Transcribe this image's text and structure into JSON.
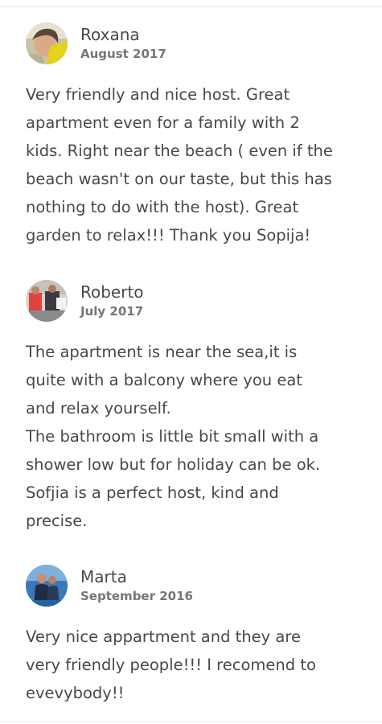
{
  "reviews": [
    {
      "name": "Roxana",
      "date": "August 2017",
      "text": "Very friendly and nice host. Great\napartment even for a family with 2\nkids. Right near the beach ( even if the\nbeach wasn't on our taste, but this has\nnothing to do with the host). Great\ngarden to relax!!! Thank you Sopija!"
    },
    {
      "name": "Roberto",
      "date": "July 2017",
      "text": "The apartment is near the sea,it is\nquite with a balcony where you eat\nand relax yourself.\nThe bathroom is little bit small with a\nshower low but for holiday can be ok.\nSofjia is a perfect host, kind and\nprecise."
    },
    {
      "name": "Marta",
      "date": "September 2016",
      "text": "Very nice appartment and they are\nvery friendly people!!! I recomend to\nevevybody!!"
    }
  ]
}
